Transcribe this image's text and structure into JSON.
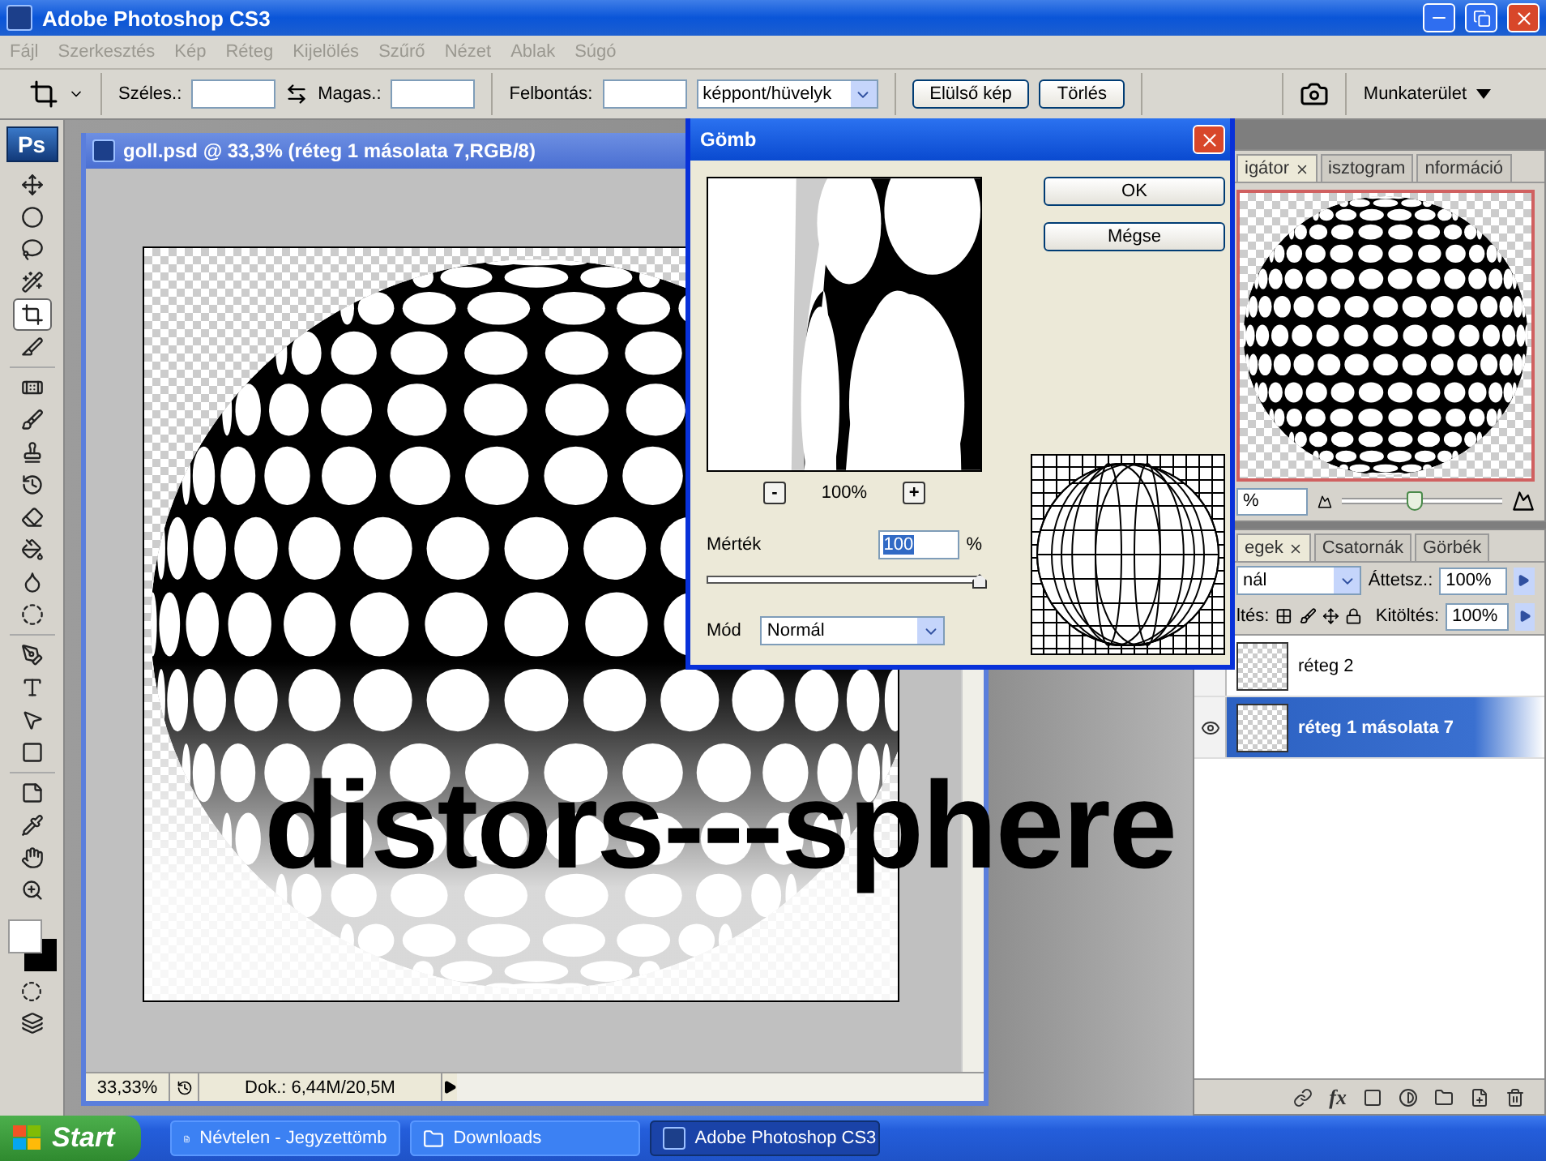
{
  "window": {
    "title": "Adobe Photoshop CS3"
  },
  "menu": [
    "Fájl",
    "Szerkesztés",
    "Kép",
    "Réteg",
    "Kijelölés",
    "Szűrő",
    "Nézet",
    "Ablak",
    "Súgó"
  ],
  "options_bar": {
    "width_label": "Széles.:",
    "height_label": "Magas.:",
    "resolution_label": "Felbontás:",
    "unit": "képpont/hüvelyk",
    "buttons": [
      "Elülső kép",
      "Törlés"
    ],
    "workspace": "Munkaterület"
  },
  "toolbox": {
    "logo": "Ps",
    "tools": [
      {
        "selected": false
      },
      {
        "selected": false
      },
      {
        "selected": false
      },
      {
        "selected": false
      },
      {
        "selected": true
      },
      {
        "selected": false
      },
      {
        "selected": false
      },
      {
        "selected": false
      },
      {
        "selected": false
      },
      {
        "selected": false
      },
      {
        "selected": false
      },
      {
        "selected": false
      },
      {
        "selected": false
      },
      {
        "selected": false
      },
      {
        "selected": false
      },
      {
        "selected": false
      },
      {
        "selected": false
      },
      {
        "selected": false
      },
      {
        "selected": false
      },
      {
        "selected": false
      },
      {
        "selected": false
      },
      {
        "selected": false
      }
    ]
  },
  "document": {
    "title": "goll.psd @ 33,3% (réteg 1 másolata 7,RGB/8)",
    "zoom": "33,33%",
    "doc_info": "Dok.: 6,44M/20,5M"
  },
  "dialog": {
    "title": "Gömb",
    "buttons": [
      "OK",
      "Mégse"
    ],
    "zoom_out": "-",
    "preview_zoom": "100%",
    "zoom_in": "+",
    "amount_label": "Mérték",
    "amount": "100",
    "unit": "%",
    "level": 1,
    "mode_label": "Mód",
    "mode": "Normál"
  },
  "navigator": {
    "tabs": [
      {
        "label": "igátor",
        "selected": true
      },
      {
        "label": "isztogram",
        "selected": false
      },
      {
        "label": "nformáció",
        "selected": false
      }
    ],
    "zoom": "%",
    "level": 0.45
  },
  "layers": {
    "tabs": [
      {
        "label": "egek",
        "selected": true
      },
      {
        "label": "Csatornák",
        "selected": false
      },
      {
        "label": "Görbék",
        "selected": false
      }
    ],
    "blend_mode": "nál",
    "opacity_label": "Áttetsz.:",
    "opacity": "100%",
    "lock_label": "ltés:",
    "fill_label": "Kitöltés:",
    "fill": "100%",
    "fx": "fx",
    "items": [
      {
        "name": "réteg 2",
        "selected": false,
        "visible": false
      },
      {
        "name": "réteg 1 másolata 7",
        "selected": true,
        "visible": true
      }
    ]
  },
  "overlay_text": "distors---sphere",
  "taskbar": {
    "start": "Start",
    "items": [
      {
        "label": "Névtelen - Jegyzettömb",
        "selected": false
      },
      {
        "label": "Downloads",
        "selected": false
      },
      {
        "label": "Adobe Photoshop CS3",
        "selected": true
      }
    ]
  }
}
